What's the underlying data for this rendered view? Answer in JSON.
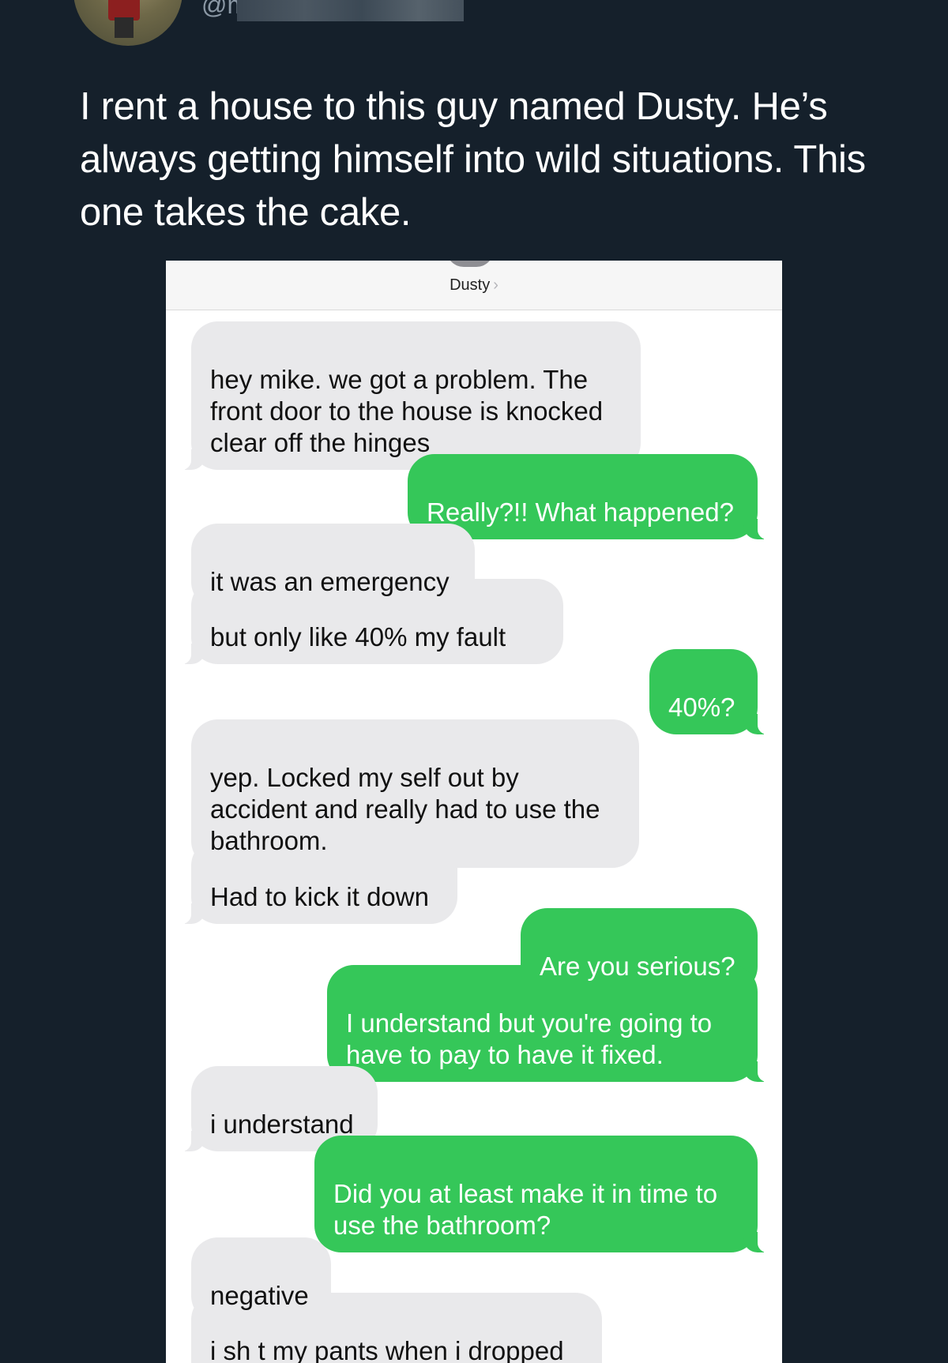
{
  "tweet": {
    "handle": "@m",
    "text": "I rent a house to this guy named Dusty. He’s always getting himself into wild situations. This one takes the cake."
  },
  "conversation": {
    "contact_name": "Dusty",
    "chevron_icon": "chevron-right-icon",
    "colors": {
      "sent": "#35c759",
      "received": "#e9e9eb"
    },
    "messages": [
      {
        "from": "them",
        "text": "hey mike.  we got a problem. The\nfront door to the house is knocked\nclear off the hinges"
      },
      {
        "from": "me",
        "text": "Really?!! What happened?"
      },
      {
        "from": "them",
        "text": "it was an emergency"
      },
      {
        "from": "them",
        "text": "but only like 40% my fault"
      },
      {
        "from": "me",
        "text": "40%?"
      },
      {
        "from": "them",
        "text": "yep. Locked my self out by\naccident and really had to use the\nbathroom."
      },
      {
        "from": "them",
        "text": "Had to kick it down"
      },
      {
        "from": "me",
        "text": "Are you serious?"
      },
      {
        "from": "me",
        "text": "I understand but you're going to\nhave to pay to have it fixed."
      },
      {
        "from": "them",
        "text": "i understand"
      },
      {
        "from": "me",
        "text": "Did you at least make it in time to\nuse the bathroom?"
      },
      {
        "from": "them",
        "text": "negative"
      },
      {
        "from": "them",
        "text": "i sh t my pants when i dropped\nkicked the door in"
      }
    ]
  }
}
